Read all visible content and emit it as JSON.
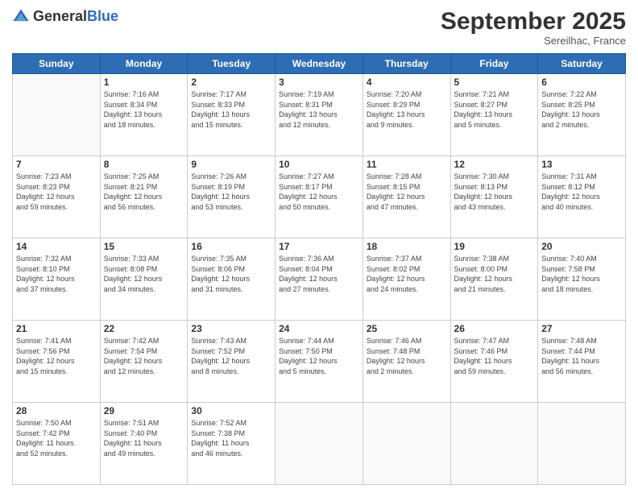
{
  "header": {
    "logo_general": "General",
    "logo_blue": "Blue",
    "month_title": "September 2025",
    "subtitle": "Sereilhac, France"
  },
  "days_of_week": [
    "Sunday",
    "Monday",
    "Tuesday",
    "Wednesday",
    "Thursday",
    "Friday",
    "Saturday"
  ],
  "weeks": [
    [
      {
        "day": "",
        "info": ""
      },
      {
        "day": "1",
        "info": "Sunrise: 7:16 AM\nSunset: 8:34 PM\nDaylight: 13 hours\nand 18 minutes."
      },
      {
        "day": "2",
        "info": "Sunrise: 7:17 AM\nSunset: 8:33 PM\nDaylight: 13 hours\nand 15 minutes."
      },
      {
        "day": "3",
        "info": "Sunrise: 7:19 AM\nSunset: 8:31 PM\nDaylight: 13 hours\nand 12 minutes."
      },
      {
        "day": "4",
        "info": "Sunrise: 7:20 AM\nSunset: 8:29 PM\nDaylight: 13 hours\nand 9 minutes."
      },
      {
        "day": "5",
        "info": "Sunrise: 7:21 AM\nSunset: 8:27 PM\nDaylight: 13 hours\nand 5 minutes."
      },
      {
        "day": "6",
        "info": "Sunrise: 7:22 AM\nSunset: 8:25 PM\nDaylight: 13 hours\nand 2 minutes."
      }
    ],
    [
      {
        "day": "7",
        "info": "Sunrise: 7:23 AM\nSunset: 8:23 PM\nDaylight: 12 hours\nand 59 minutes."
      },
      {
        "day": "8",
        "info": "Sunrise: 7:25 AM\nSunset: 8:21 PM\nDaylight: 12 hours\nand 56 minutes."
      },
      {
        "day": "9",
        "info": "Sunrise: 7:26 AM\nSunset: 8:19 PM\nDaylight: 12 hours\nand 53 minutes."
      },
      {
        "day": "10",
        "info": "Sunrise: 7:27 AM\nSunset: 8:17 PM\nDaylight: 12 hours\nand 50 minutes."
      },
      {
        "day": "11",
        "info": "Sunrise: 7:28 AM\nSunset: 8:15 PM\nDaylight: 12 hours\nand 47 minutes."
      },
      {
        "day": "12",
        "info": "Sunrise: 7:30 AM\nSunset: 8:13 PM\nDaylight: 12 hours\nand 43 minutes."
      },
      {
        "day": "13",
        "info": "Sunrise: 7:31 AM\nSunset: 8:12 PM\nDaylight: 12 hours\nand 40 minutes."
      }
    ],
    [
      {
        "day": "14",
        "info": "Sunrise: 7:32 AM\nSunset: 8:10 PM\nDaylight: 12 hours\nand 37 minutes."
      },
      {
        "day": "15",
        "info": "Sunrise: 7:33 AM\nSunset: 8:08 PM\nDaylight: 12 hours\nand 34 minutes."
      },
      {
        "day": "16",
        "info": "Sunrise: 7:35 AM\nSunset: 8:06 PM\nDaylight: 12 hours\nand 31 minutes."
      },
      {
        "day": "17",
        "info": "Sunrise: 7:36 AM\nSunset: 8:04 PM\nDaylight: 12 hours\nand 27 minutes."
      },
      {
        "day": "18",
        "info": "Sunrise: 7:37 AM\nSunset: 8:02 PM\nDaylight: 12 hours\nand 24 minutes."
      },
      {
        "day": "19",
        "info": "Sunrise: 7:38 AM\nSunset: 8:00 PM\nDaylight: 12 hours\nand 21 minutes."
      },
      {
        "day": "20",
        "info": "Sunrise: 7:40 AM\nSunset: 7:58 PM\nDaylight: 12 hours\nand 18 minutes."
      }
    ],
    [
      {
        "day": "21",
        "info": "Sunrise: 7:41 AM\nSunset: 7:56 PM\nDaylight: 12 hours\nand 15 minutes."
      },
      {
        "day": "22",
        "info": "Sunrise: 7:42 AM\nSunset: 7:54 PM\nDaylight: 12 hours\nand 12 minutes."
      },
      {
        "day": "23",
        "info": "Sunrise: 7:43 AM\nSunset: 7:52 PM\nDaylight: 12 hours\nand 8 minutes."
      },
      {
        "day": "24",
        "info": "Sunrise: 7:44 AM\nSunset: 7:50 PM\nDaylight: 12 hours\nand 5 minutes."
      },
      {
        "day": "25",
        "info": "Sunrise: 7:46 AM\nSunset: 7:48 PM\nDaylight: 12 hours\nand 2 minutes."
      },
      {
        "day": "26",
        "info": "Sunrise: 7:47 AM\nSunset: 7:46 PM\nDaylight: 11 hours\nand 59 minutes."
      },
      {
        "day": "27",
        "info": "Sunrise: 7:48 AM\nSunset: 7:44 PM\nDaylight: 11 hours\nand 56 minutes."
      }
    ],
    [
      {
        "day": "28",
        "info": "Sunrise: 7:50 AM\nSunset: 7:42 PM\nDaylight: 11 hours\nand 52 minutes."
      },
      {
        "day": "29",
        "info": "Sunrise: 7:51 AM\nSunset: 7:40 PM\nDaylight: 11 hours\nand 49 minutes."
      },
      {
        "day": "30",
        "info": "Sunrise: 7:52 AM\nSunset: 7:38 PM\nDaylight: 11 hours\nand 46 minutes."
      },
      {
        "day": "",
        "info": ""
      },
      {
        "day": "",
        "info": ""
      },
      {
        "day": "",
        "info": ""
      },
      {
        "day": "",
        "info": ""
      }
    ]
  ]
}
